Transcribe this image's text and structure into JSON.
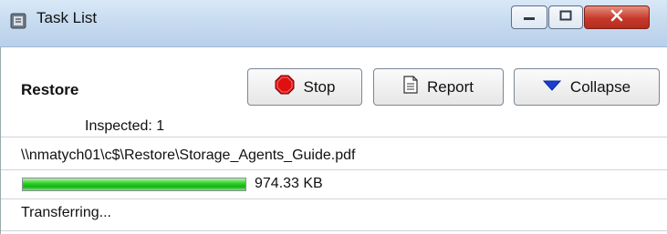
{
  "window": {
    "title": "Task List",
    "controls": {
      "minimize": "minimize",
      "maximize": "maximize",
      "close": "close"
    }
  },
  "panel": {
    "heading": "Restore",
    "buttons": {
      "stop": "Stop",
      "report": "Report",
      "collapse": "Collapse"
    },
    "inspected_label": "Inspected: 1",
    "file_path": "\\\\nmatych01\\c$\\Restore\\Storage_Agents_Guide.pdf",
    "progress": {
      "value": 1.0,
      "size_label": "974.33 KB"
    },
    "status_text": "Transferring..."
  },
  "colors": {
    "progress_green": "#1fc41b",
    "stop_red": "#e01010",
    "collapse_blue": "#1a3fd0"
  },
  "icons": {
    "app": "task-list-icon",
    "stop": "stop-sign-icon",
    "report": "document-icon",
    "collapse": "triangle-down-icon"
  }
}
